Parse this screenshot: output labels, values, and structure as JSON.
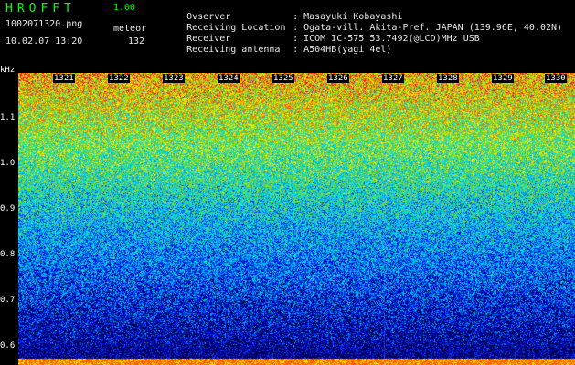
{
  "header": {
    "app_title": "HROFFT",
    "version": "1.00",
    "filename": "1002071320.png",
    "detection_type": "meteor",
    "datetime": "10.02.07 13:20",
    "count": "132",
    "info": [
      {
        "label": "Ovserver",
        "sep": ":",
        "value": "Masayuki Kobayashi"
      },
      {
        "label": "Receiving Location",
        "sep": ":",
        "value": "Ogata-vill. Akita-Pref. JAPAN (139.96E, 40.02N)"
      },
      {
        "label": "Receiver",
        "sep": ":",
        "value": "ICOM IC-575 53.7492(@LCD)MHz USB"
      },
      {
        "label": "Receiving antenna",
        "sep": ":",
        "value": "A504HB(yagi 4el)"
      }
    ]
  },
  "spectrogram": {
    "freq_unit": "kHz",
    "y_ticks": [
      "1.1",
      "1.0",
      "0.9",
      "0.8",
      "0.7",
      "0.6"
    ],
    "x_ticks": [
      "1321",
      "1322",
      "1323",
      "1324",
      "1325",
      "1326",
      "1327",
      "1328",
      "1329",
      "1330"
    ],
    "colors": [
      "#000050",
      "#0000c8",
      "#0040ff",
      "#00a0ff",
      "#00e0e0",
      "#40d080",
      "#a0e000",
      "#ffe000",
      "#ff6000",
      "#ff0040"
    ]
  }
}
